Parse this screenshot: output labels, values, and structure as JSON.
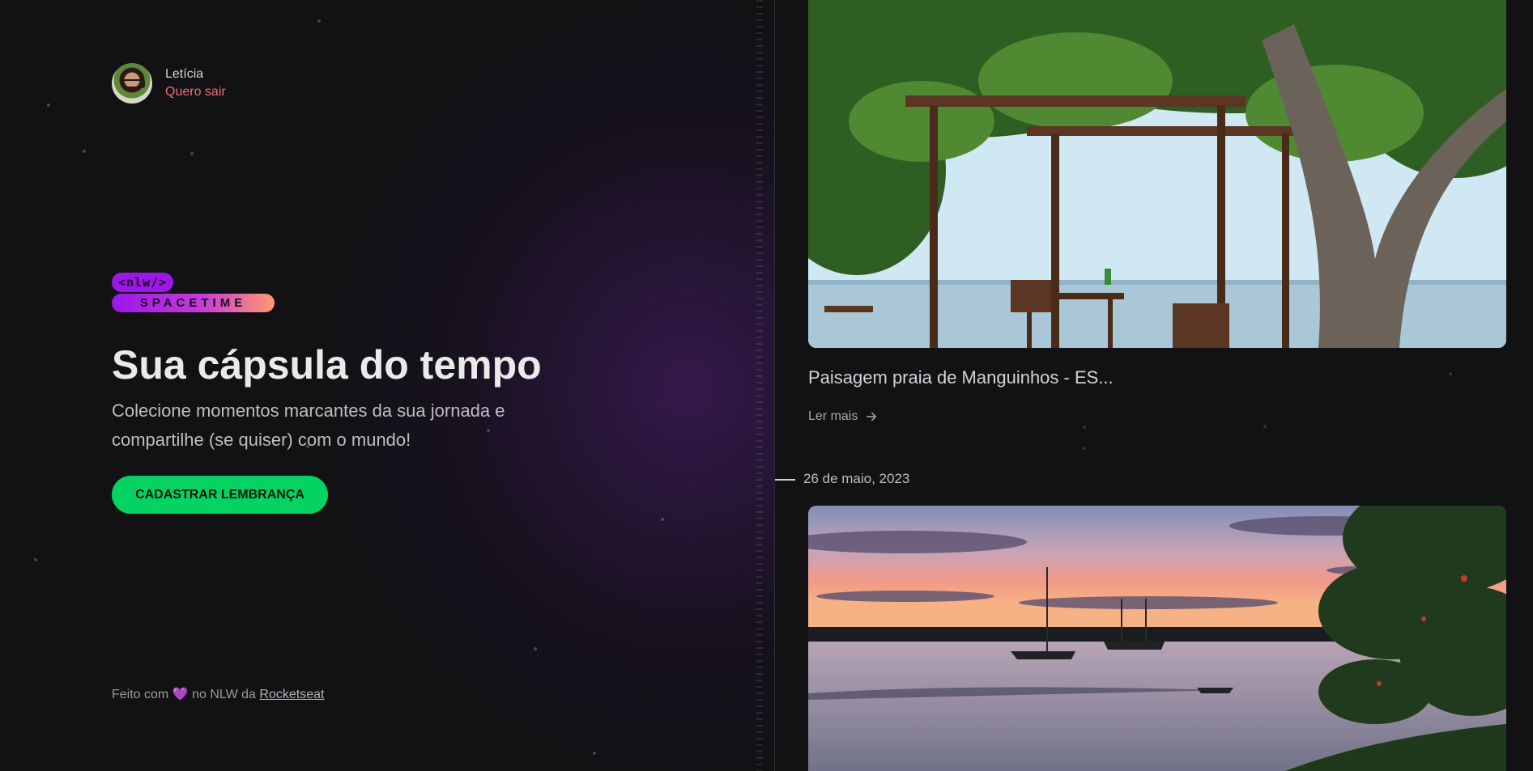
{
  "user": {
    "name": "Letícia",
    "logout_label": "Quero sair",
    "avatar_alt": "avatar"
  },
  "logo": {
    "tag": "<nlw/>",
    "wordmark": "SPACETIME"
  },
  "hero": {
    "title": "Sua cápsula do tempo",
    "description": "Colecione momentos marcantes da sua jornada e compartilhe (se quiser) com o mundo!",
    "cta_label": "CADASTRAR LEMBRANÇA"
  },
  "footer": {
    "prefix": "Feito com",
    "heart": "💜",
    "middle": "no NLW da",
    "link_label": "Rocketseat"
  },
  "memories": [
    {
      "caption": "Paisagem praia de Manguinhos - ES...",
      "read_more_label": "Ler mais",
      "image": "beach-pergola-photo"
    },
    {
      "date": "26 de maio, 2023",
      "image": "sunset-sailboats-photo"
    }
  ],
  "colors": {
    "background": "#121215",
    "accent_green": "#04d361",
    "logout_red": "#ef6e7a",
    "logo_purple": "#9b18e8",
    "logo_orange": "#ff9a6b"
  },
  "icons": {
    "read_more": "arrow-right-icon",
    "heart": "heart-icon"
  }
}
